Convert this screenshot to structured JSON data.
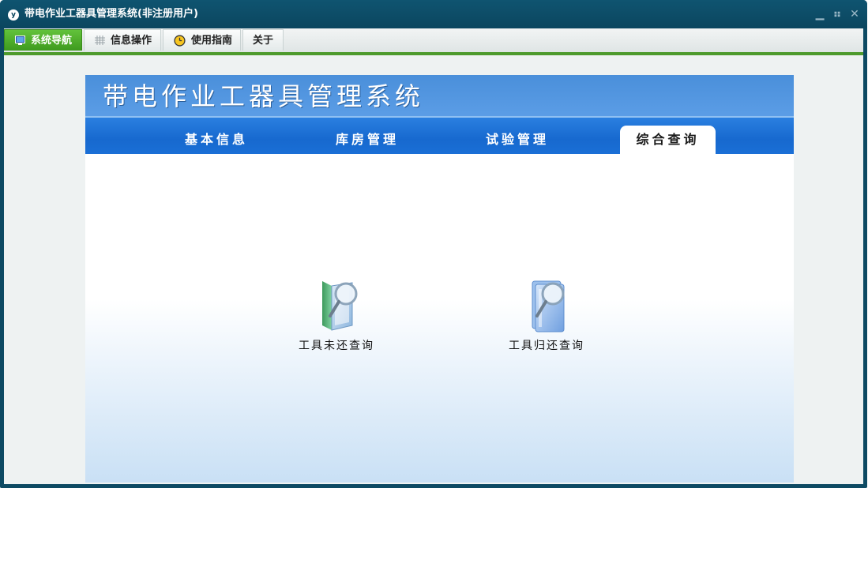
{
  "window": {
    "title": "带电作业工器具管理系统(非注册用户)",
    "app_icon_glyph": "y",
    "controls": {
      "minimize": "▁",
      "restore": "⠶",
      "close": "✕"
    }
  },
  "menubar": {
    "tabs": [
      {
        "label": "系统导航",
        "icon": "monitor-icon",
        "active": true
      },
      {
        "label": "信息操作",
        "icon": "grid-icon",
        "active": false
      },
      {
        "label": "使用指南",
        "icon": "clock-icon",
        "active": false
      },
      {
        "label": "关于",
        "icon": "",
        "active": false
      }
    ]
  },
  "main": {
    "banner_title": "带电作业工器具管理系统",
    "nav": [
      {
        "label": "基本信息",
        "active": false
      },
      {
        "label": "库房管理",
        "active": false
      },
      {
        "label": "试验管理",
        "active": false
      },
      {
        "label": "综合查询",
        "active": true
      }
    ],
    "cards": [
      {
        "label": "工具未还查询",
        "icon": "book-search-icon"
      },
      {
        "label": "工具归还查询",
        "icon": "folder-search-icon"
      }
    ]
  },
  "colors": {
    "titlebar": "#0d4a63",
    "active_tab": "#4fae2a",
    "accent_line": "#4d9a2c",
    "banner": "#4a8fda",
    "navbar": "#1769cf"
  }
}
